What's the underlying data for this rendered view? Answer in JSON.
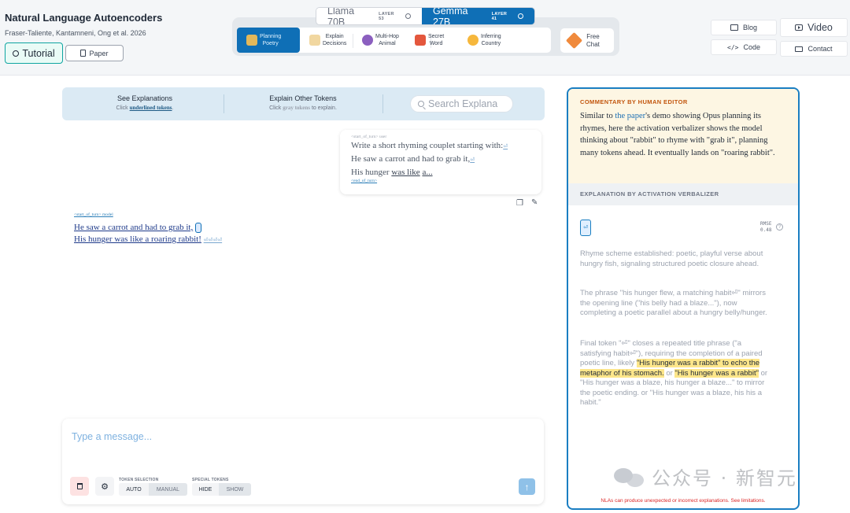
{
  "header": {
    "title": "Natural Language Autoencoders",
    "authors": "Fraser-Taliente, Kantamneni, Ong et al. 2026",
    "tutorial_label": "Tutorial",
    "paper_label": "Paper"
  },
  "models": [
    {
      "name": "Llama 70B",
      "layer": "LAYER 53",
      "active": false
    },
    {
      "name": "Gemma 27B",
      "layer": "LAYER 41",
      "active": true
    }
  ],
  "scenarios": [
    {
      "label1": "Planning",
      "label2": "Poetry",
      "icon": "scroll-icon",
      "active": true
    },
    {
      "label1": "Explain",
      "label2": "Decisions",
      "icon": "scales-icon"
    },
    {
      "label1": "Multi-Hop",
      "label2": "Animal",
      "icon": "eggplant-icon"
    },
    {
      "label1": "Secret",
      "label2": "Word",
      "icon": "gift-icon"
    },
    {
      "label1": "Inferring",
      "label2": "Country",
      "icon": "face-icon"
    }
  ],
  "free_chat": {
    "label1": "Free",
    "label2": "Chat",
    "icon": "pencil-icon"
  },
  "top_links": {
    "blog": "Blog",
    "video": "Video",
    "code": "Code",
    "contact": "Contact"
  },
  "modes": {
    "see_title": "See Explanations",
    "see_sub_prefix": "Click",
    "see_sub_bold": "underlined tokens",
    "see_sub_suffix": ".",
    "other_title": "Explain Other Tokens",
    "other_sub_prefix": "Click",
    "other_sub_bold": "gray tokens",
    "other_sub_suffix": "to explain."
  },
  "search": {
    "placeholder": "Search Explana"
  },
  "conversation": {
    "user_start": "<start_of_turn> user",
    "user_line1": "Write a short rhyming couplet starting with:",
    "user_line2": "He saw a carrot and had to grab it,",
    "user_line3_a": "His hunger",
    "user_line3_b": "was like",
    "user_line3_c": "a...",
    "user_end": "<end_of_turn>",
    "model_start": "<start_of_turn> model",
    "model_line1": "He saw a carrot and had to grab it,",
    "model_line2": "His hunger was like a roaring rabbit!",
    "newline_glyph": "⏎",
    "trailing_glyphs": "⏎⏎⏎⏎"
  },
  "composer": {
    "placeholder": "Type a message...",
    "token_selection_label": "TOKEN SELECTION",
    "auto": "AUTO",
    "manual": "MANUAL",
    "special_tokens_label": "SPECIAL TOKENS",
    "hide": "HIDE",
    "show": "SHOW",
    "send_icon": "arrow-up-icon"
  },
  "panel": {
    "commentary_head": "COMMENTARY BY HUMAN EDITOR",
    "commentary_a": "Similar to",
    "commentary_link": "the paper",
    "commentary_b": "'s demo showing Opus planning its rhymes, here the activation verbalizer shows the model thinking about \"rabbit\" to rhyme with \"grab it\", planning many tokens ahead. It eventually lands on \"roaring rabbit\".",
    "verbalizer_head": "EXPLANATION BY ACTIVATION VERBALIZER",
    "token_glyph": "⏎",
    "rmse_label": "RMSE",
    "rmse_value": "0.48",
    "expl1": "Rhyme scheme established: poetic, playful verse about hungry fish, signaling structured poetic closure ahead.",
    "expl2": "The phrase \"his hunger flew, a matching habit⏎\" mirrors the opening line (\"his belly had a blaze...\"), now completing a poetic parallel about a hungry belly/hunger.",
    "expl3_a": "Final token \"⏎\" closes a repeated title phrase (\"a satisfying habit⏎\"), requiring the completion of a paired poetic line, likely",
    "expl3_hl1": "\"His hunger was a rabbit\" to echo the metaphor of his stomach.",
    "expl3_b": "or",
    "expl3_hl2": "\"His hunger was a rabbit\"",
    "expl3_c": "or \"His hunger was a blaze, his hunger a blaze...\" to mirror the poetic ending. or \"His hunger was a blaze, his his a habit.\"",
    "disclaimer": "NLAs can produce unexpected or incorrect explanations. See limitations."
  },
  "watermark": {
    "text": "公众号 · 新智元"
  },
  "colors": {
    "accent": "#0f6fb6",
    "panel_border": "#1a7ec2",
    "highlight": "#fde68a",
    "commentary_bg": "#fdf6e3"
  }
}
